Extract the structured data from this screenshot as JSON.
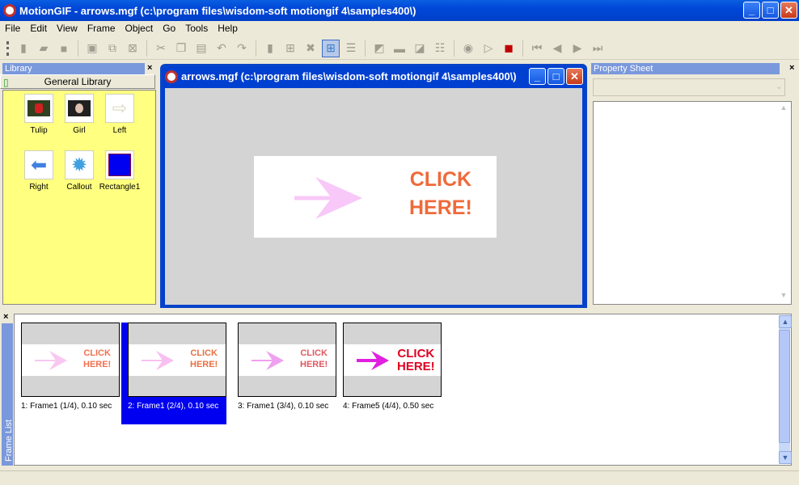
{
  "window": {
    "title": "MotionGIF - arrows.mgf (c:\\program files\\wisdom-soft motiongif 4\\samples400\\)",
    "minimize": "_",
    "maximize": "□",
    "close": "✕"
  },
  "menu": [
    "File",
    "Edit",
    "View",
    "Frame",
    "Object",
    "Go",
    "Tools",
    "Help"
  ],
  "toolbar": {
    "buttons": [
      "new-icon",
      "open-icon",
      "save-icon",
      "add-frame-icon",
      "duplicate-frame-icon",
      "delete-frame-icon",
      "cut-icon",
      "copy-icon",
      "paste-icon",
      "undo-icon",
      "redo-icon",
      "page-icon",
      "grid-icon",
      "tools-icon",
      "thumbnail-view-icon",
      "list-view-icon",
      "image-properties-icon",
      "filmstrip-icon",
      "layers-icon",
      "checklist-icon",
      "preview-browser-icon",
      "play-icon",
      "stop-icon",
      "first-frame-icon",
      "previous-frame-icon",
      "next-frame-icon",
      "last-frame-icon"
    ],
    "active": "thumbnail-view-icon",
    "stop_color": "#c00000"
  },
  "library": {
    "title": "Library",
    "close": "×",
    "group": "General Library",
    "items": [
      {
        "label": "Tulip",
        "icon": "tulip-image-icon"
      },
      {
        "label": "Girl",
        "icon": "girl-image-icon"
      },
      {
        "label": "Left",
        "icon": "arrow-right-outline-icon"
      },
      {
        "label": "Right",
        "icon": "arrow-left-blue-icon"
      },
      {
        "label": "Callout",
        "icon": "callout-icon"
      },
      {
        "label": "Rectangle1",
        "icon": "rectangle-icon"
      }
    ]
  },
  "document": {
    "title": "arrows.mgf (c:\\program files\\wisdom-soft motiongif 4\\samples400\\)",
    "stage_text_line1": "CLICK",
    "stage_text_line2": "HERE!",
    "text_color": "#ef6a3a",
    "arrow_color": "#f8c8f8"
  },
  "property_sheet": {
    "title": "Property Sheet",
    "close": "×",
    "selected": ""
  },
  "frame_list": {
    "title": "Frame List",
    "close": "×",
    "selected_index": 1,
    "frames": [
      {
        "caption": "1: Frame1 (1/4), 0.10 sec",
        "text1": "CLICK",
        "text2": "HERE!",
        "text_color": "#f07050",
        "arrow_color": "#f8c8f0"
      },
      {
        "caption": "2: Frame1 (2/4), 0.10 sec",
        "text1": "CLICK",
        "text2": "HERE!",
        "text_color": "#e87040",
        "arrow_color": "#f8c0f0"
      },
      {
        "caption": "3: Frame1 (3/4), 0.10 sec",
        "text1": "CLICK",
        "text2": "HERE!",
        "text_color": "#e05860",
        "arrow_color": "#f0a0f0"
      },
      {
        "caption": "4: Frame5 (4/4), 0.50 sec",
        "text1": "CLICK",
        "text2": "HERE!",
        "text_color": "#e00020",
        "arrow_color": "#e020e0"
      }
    ]
  }
}
